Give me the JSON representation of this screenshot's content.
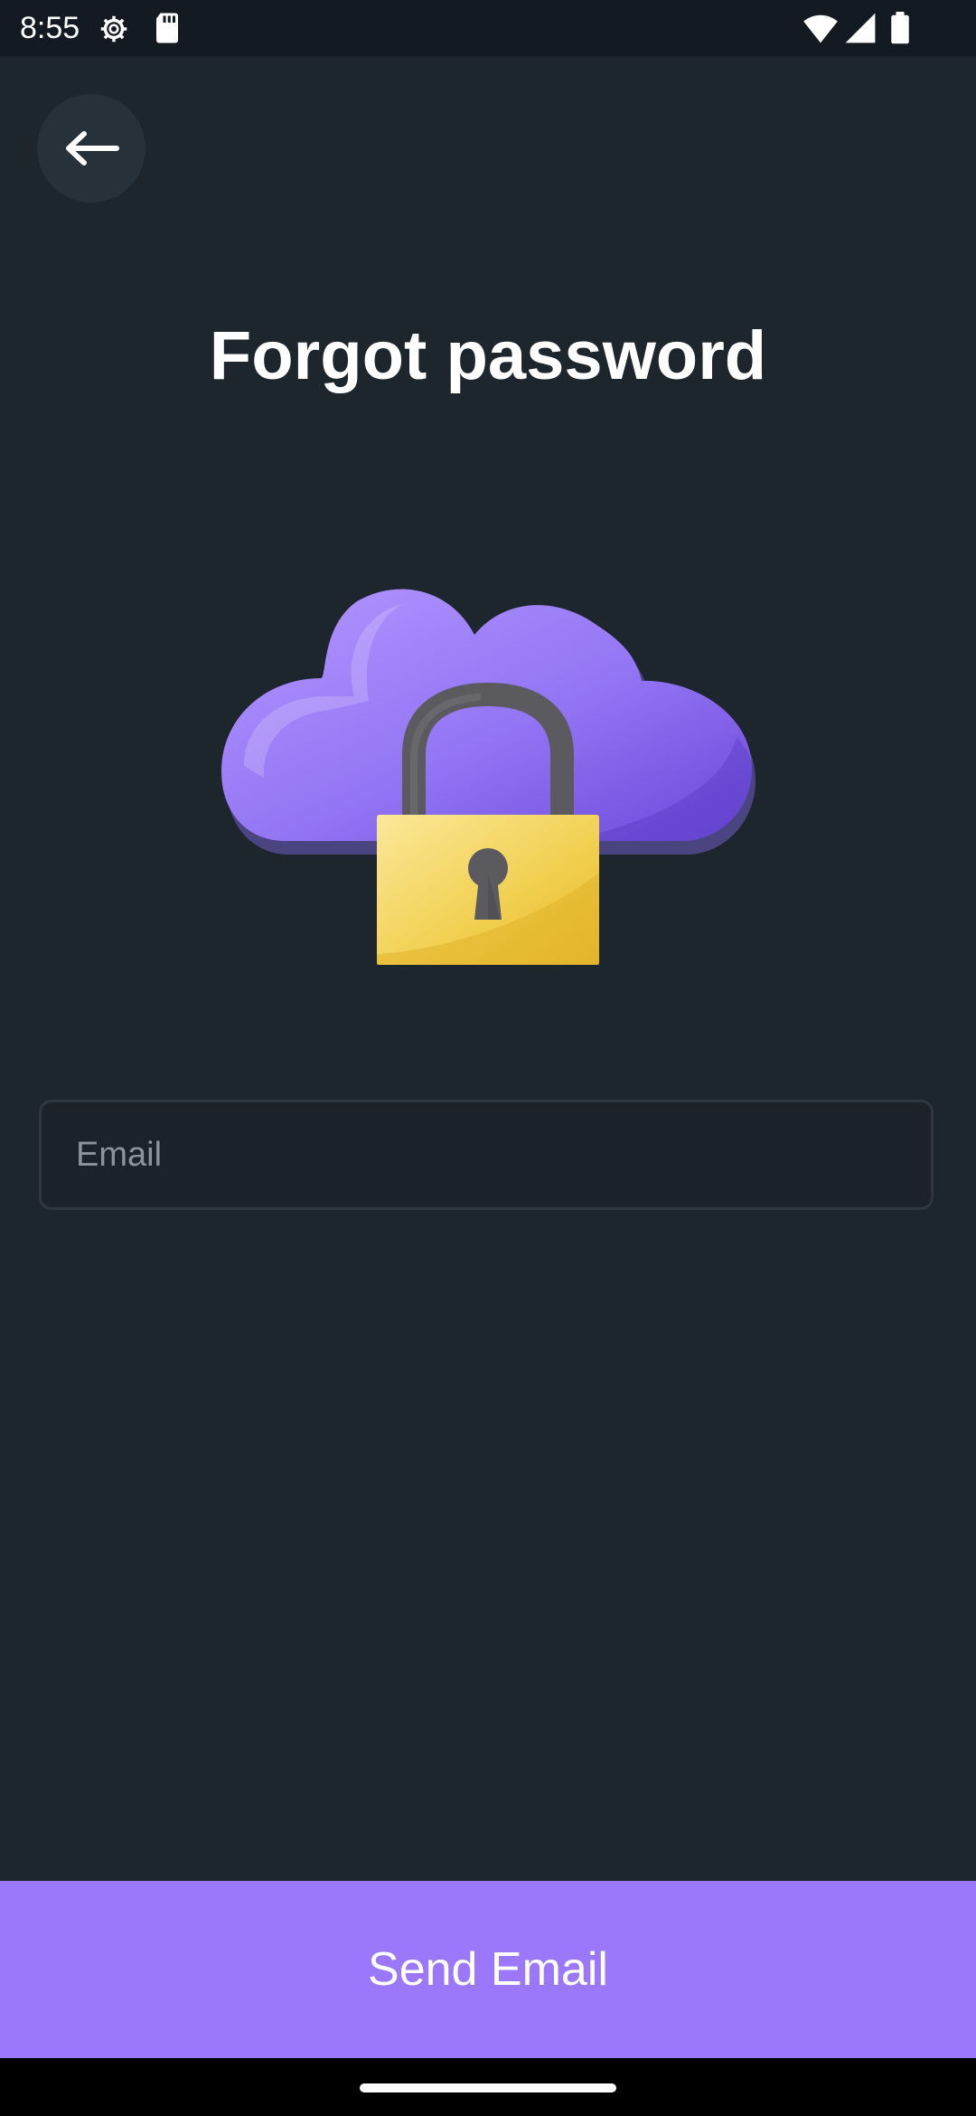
{
  "status_bar": {
    "time": "8:55",
    "icons": [
      "settings-gear-icon",
      "sd-card-icon",
      "wifi-icon",
      "cell-signal-icon",
      "battery-icon"
    ]
  },
  "header": {
    "back_icon": "arrow-left-icon",
    "title": "Forgot password"
  },
  "illustration": {
    "name": "cloud-lock-illustration",
    "colors": {
      "cloud": "#9b7bf7",
      "cloud_shadow": "#4a4580",
      "lock_body": "#f2cf4f",
      "shackle": "#5b5b5f"
    }
  },
  "form": {
    "email_placeholder": "Email",
    "email_value": ""
  },
  "actions": {
    "send_label": "Send Email"
  },
  "theme": {
    "background": "#1d252d",
    "accent": "#9a78f9"
  }
}
